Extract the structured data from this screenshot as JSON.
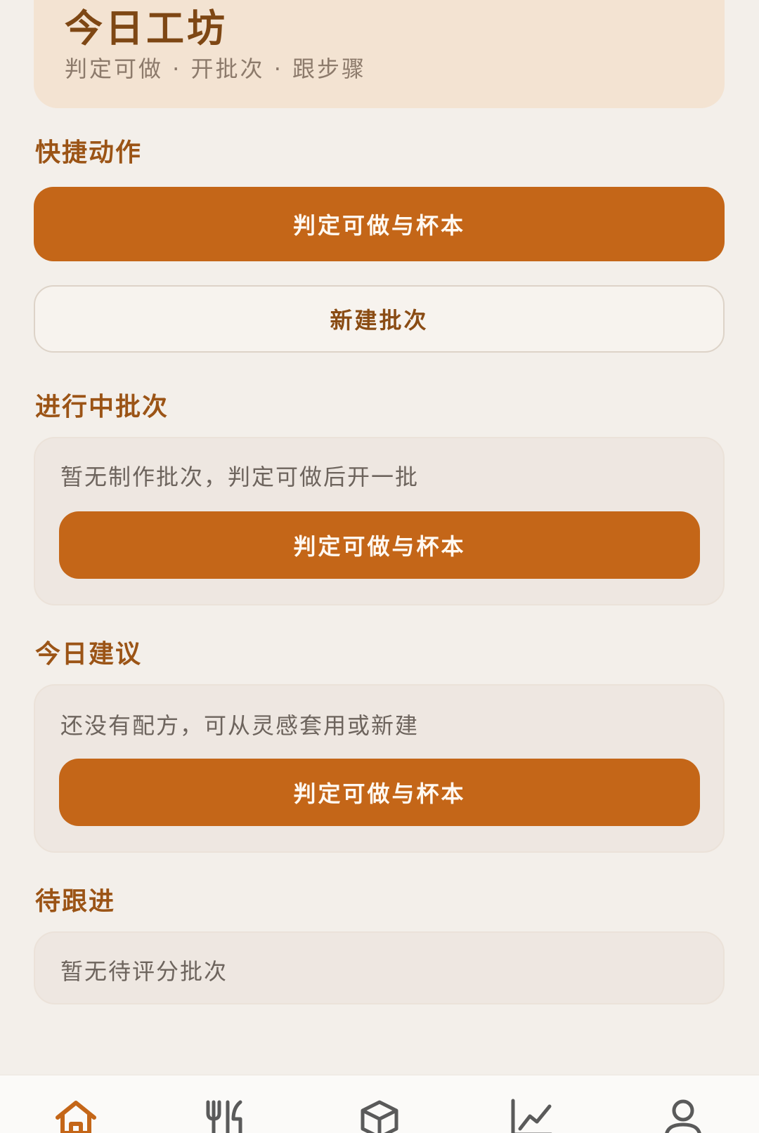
{
  "hero": {
    "title": "今日工坊",
    "subtitle": "判定可做 · 开批次 · 跟步骤"
  },
  "quick_actions": {
    "title": "快捷动作",
    "primary_label": "判定可做与杯本",
    "secondary_label": "新建批次"
  },
  "in_progress": {
    "title": "进行中批次",
    "empty_text": "暂无制作批次，判定可做后开一批",
    "button_label": "判定可做与杯本"
  },
  "suggestions": {
    "title": "今日建议",
    "empty_text": "还没有配方，可从灵感套用或新建",
    "button_label": "判定可做与杯本"
  },
  "follow_up": {
    "title": "待跟进",
    "empty_text": "暂无待评分批次"
  },
  "tabbar": {
    "active_color": "#c46618",
    "inactive_color": "#5a5a5a",
    "tabs": [
      {
        "icon": "home-icon",
        "active": true
      },
      {
        "icon": "utensils-icon",
        "active": false
      },
      {
        "icon": "box-icon",
        "active": false
      },
      {
        "icon": "chart-line-icon",
        "active": false
      },
      {
        "icon": "user-icon",
        "active": false
      }
    ]
  }
}
